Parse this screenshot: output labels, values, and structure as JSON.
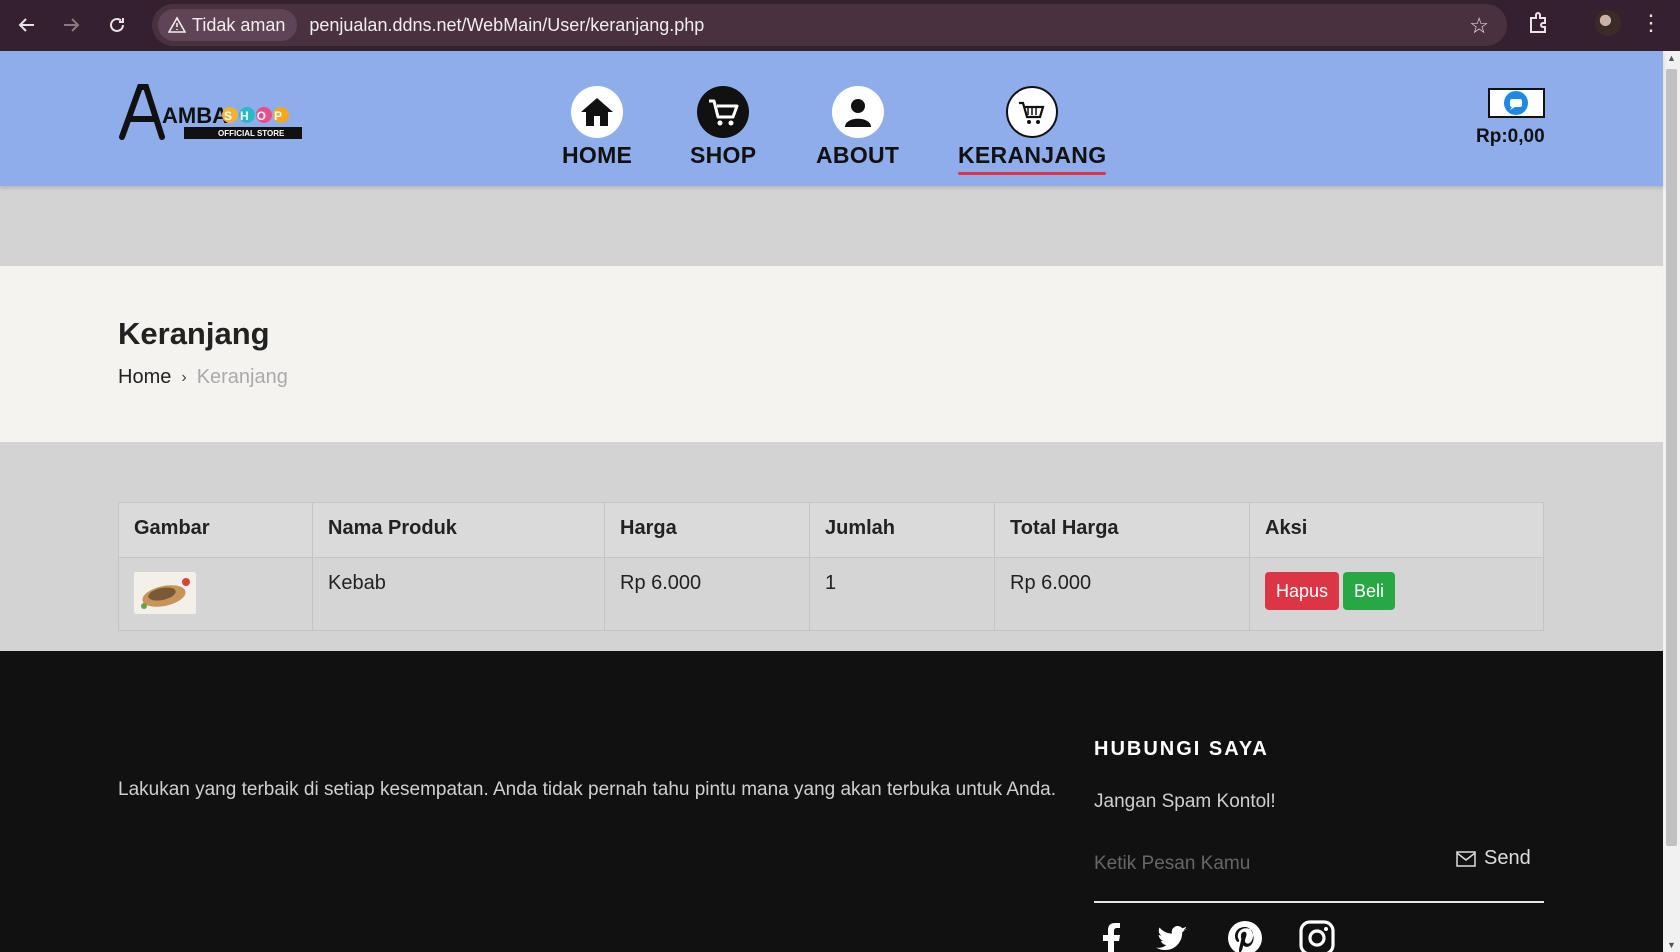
{
  "browser": {
    "security_label": "Tidak aman",
    "url": "penjualan.ddns.net/WebMain/User/keranjang.php"
  },
  "header": {
    "logo_text": "AMBA",
    "logo_shop": "SHOP",
    "logo_tagline": "OFFICIAL STORE",
    "nav": [
      {
        "label": "HOME",
        "icon": "home-icon"
      },
      {
        "label": "SHOP",
        "icon": "cart-icon"
      },
      {
        "label": "ABOUT",
        "icon": "user-icon"
      },
      {
        "label": "KERANJANG",
        "icon": "basket-icon",
        "active": true
      }
    ],
    "cart_total": "Rp:0,00"
  },
  "page": {
    "title": "Keranjang",
    "breadcrumb": {
      "home": "Home",
      "current": "Keranjang"
    }
  },
  "cart_table": {
    "headers": [
      "Gambar",
      "Nama Produk",
      "Harga",
      "Jumlah",
      "Total Harga",
      "Aksi"
    ],
    "rows": [
      {
        "name": "Kebab",
        "price": "Rp 6.000",
        "qty": "1",
        "total": "Rp 6.000"
      }
    ],
    "delete_label": "Hapus",
    "buy_label": "Beli"
  },
  "footer": {
    "tagline": "Lakukan yang terbaik di setiap kesempatan. Anda tidak pernah tahu pintu mana yang akan terbuka untuk Anda.",
    "contact_heading": "HUBUNGI SAYA",
    "contact_note": "Jangan Spam Kontol!",
    "message_placeholder": "Ketik Pesan Kamu",
    "send_label": "Send",
    "social": [
      "facebook-icon",
      "twitter-icon",
      "pinterest-icon",
      "instagram-icon"
    ]
  },
  "colors": {
    "header_bg": "#8fadea",
    "active_underline": "#e0333f",
    "delete_button": "#dc3545",
    "buy_button": "#28a745",
    "footer_bg": "#111111"
  }
}
